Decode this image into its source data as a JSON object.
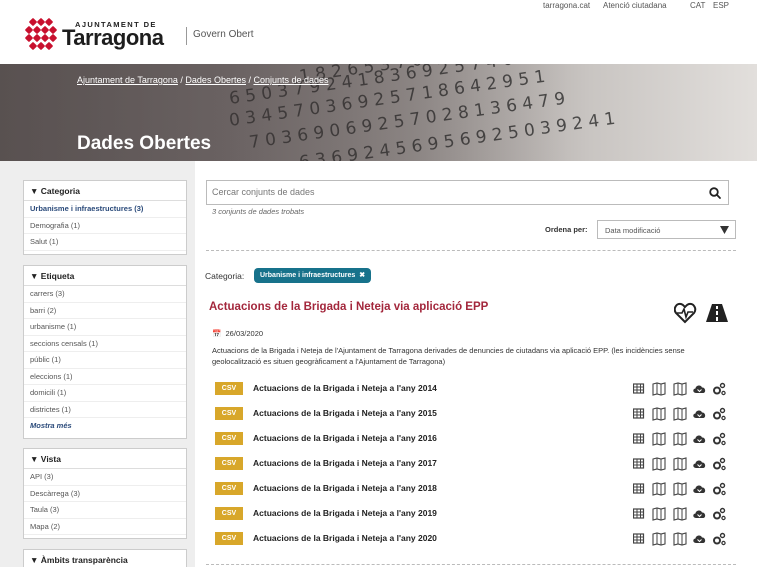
{
  "header": {
    "brand_small": "AJUNTAMENT DE",
    "brand_name": "Tarragona",
    "section": "Govern Obert",
    "links": [
      "tarragona.cat",
      "Atenció ciutadana"
    ],
    "languages": [
      "CAT",
      "ESP"
    ],
    "accent_color": "#c8102e"
  },
  "hero": {
    "breadcrumb": [
      "Ajuntament de Tarragona",
      "Dades Obertes",
      "Conjunts de dades"
    ],
    "title": "Dades Obertes"
  },
  "facets": [
    {
      "title": "Categoria",
      "items": [
        "Urbanisme i infraestructures (3)",
        "Demografia (1)",
        "Salut (1)"
      ],
      "active": 0
    },
    {
      "title": "Etiqueta",
      "items": [
        "carrers (3)",
        "barri (2)",
        "urbanisme (1)",
        "seccions censals (1)",
        "públic (1)",
        "eleccions (1)",
        "domicili (1)",
        "districtes (1)"
      ],
      "more": "Mostra més"
    },
    {
      "title": "Vista",
      "items": [
        "API (3)",
        "Descàrrega (3)",
        "Taula (3)",
        "Mapa (2)"
      ]
    },
    {
      "title": "Àmbits transparència",
      "items": []
    }
  ],
  "search": {
    "placeholder": "Cercar conjunts de dades",
    "icon": "search-icon",
    "found": "3 conjunts de dades trobats"
  },
  "sort": {
    "label": "Ordena per:",
    "value": "Data modificació"
  },
  "filter": {
    "label": "Categoria:",
    "pill": "Urbanisme i infraestructures",
    "pill_color": "#17728b"
  },
  "dataset": {
    "title": "Actuacions de la Brigada i Neteja via aplicació EPP",
    "title_color": "#a3273c",
    "date": "26/03/2020",
    "description": "Actuacions de la Brigada i Neteja de l'Ajuntament de Tarragona derivades de denuncies de ciutadans via aplicació EPP. (les incidències sense geolocalització es situen geogràficament a l'Ajuntament de Tarragona)",
    "icons": [
      "heartbeat-icon",
      "road-icon"
    ],
    "resources": [
      {
        "format": "CSV",
        "name": "Actuacions de la Brigada i Neteja a l'any 2014"
      },
      {
        "format": "CSV",
        "name": "Actuacions de la Brigada i Neteja a l'any 2015"
      },
      {
        "format": "CSV",
        "name": "Actuacions de la Brigada i Neteja a l'any 2016"
      },
      {
        "format": "CSV",
        "name": "Actuacions de la Brigada i Neteja a l'any 2017"
      },
      {
        "format": "CSV",
        "name": "Actuacions de la Brigada i Neteja a l'any 2018"
      },
      {
        "format": "CSV",
        "name": "Actuacions de la Brigada i Neteja a l'any 2019"
      },
      {
        "format": "CSV",
        "name": "Actuacions de la Brigada i Neteja a l'any 2020"
      }
    ],
    "resource_icons": [
      "table-icon",
      "map-icon",
      "map-icon",
      "cloud-download-icon",
      "gears-icon"
    ],
    "badge_color": "#d8a72a"
  }
}
